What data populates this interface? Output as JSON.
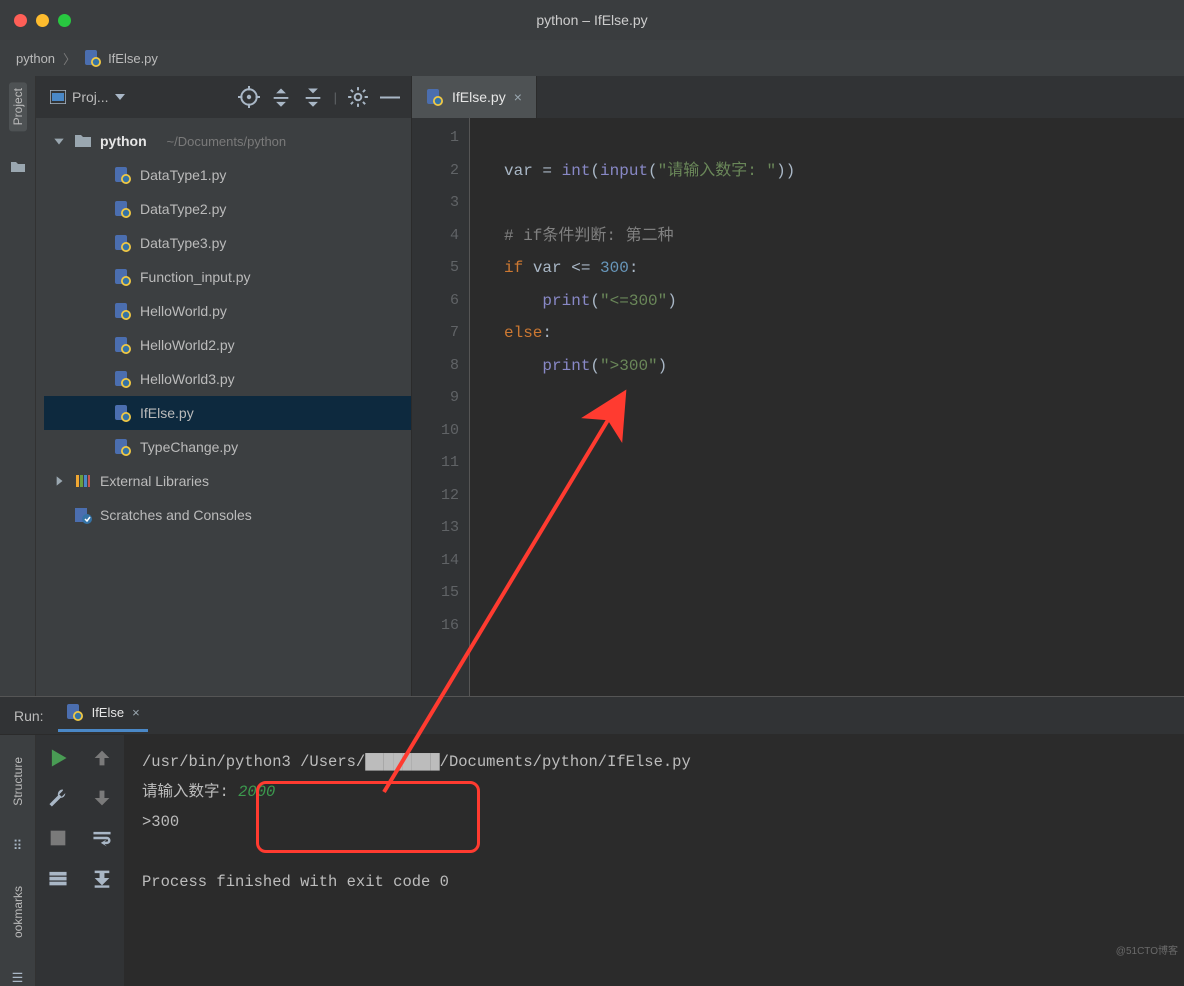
{
  "window": {
    "title": "python – IfElse.py"
  },
  "breadcrumb": {
    "root": "python",
    "file": "IfElse.py"
  },
  "project_panel": {
    "title": "Proj...",
    "root": {
      "name": "python",
      "path": "~/Documents/python"
    },
    "files": [
      "DataType1.py",
      "DataType2.py",
      "DataType3.py",
      "Function_input.py",
      "HelloWorld.py",
      "HelloWorld2.py",
      "HelloWorld3.py",
      "IfElse.py",
      "TypeChange.py"
    ],
    "selected": "IfElse.py",
    "external_libs": "External Libraries",
    "scratches": "Scratches and Consoles"
  },
  "sidebar": {
    "project": "Project",
    "structure": "Structure",
    "bookmarks": "ookmarks"
  },
  "editor": {
    "tab": "IfElse.py",
    "lines": [
      "1",
      "2",
      "3",
      "4",
      "5",
      "6",
      "7",
      "8",
      "9",
      "10",
      "11",
      "12",
      "13",
      "14",
      "15",
      "16"
    ],
    "code": {
      "l2": {
        "a": "var = ",
        "b": "int",
        "c": "(",
        "d": "input",
        "e": "(",
        "f": "\"请输入数字: \"",
        "g": "))"
      },
      "l4": {
        "a": "# if条件判断: 第二种"
      },
      "l5": {
        "a": "if ",
        "b": "var <= ",
        "c": "300",
        "d": ":"
      },
      "l6": {
        "a": "    ",
        "b": "print",
        "c": "(",
        "d": "\"<=300\"",
        "e": ")"
      },
      "l7": {
        "a": "else",
        "b": ":"
      },
      "l8": {
        "a": "    ",
        "b": "print",
        "c": "(",
        "d": "\">300\"",
        "e": ")"
      }
    }
  },
  "run": {
    "label": "Run:",
    "tab": "IfElse",
    "console": {
      "cmd": "/usr/bin/python3 /Users/████████/Documents/python/IfElse.py",
      "prompt": "请输入数字: ",
      "input": "2000",
      "output": ">300",
      "exit": "Process finished with exit code 0"
    }
  },
  "watermark": "@51CTO博客"
}
